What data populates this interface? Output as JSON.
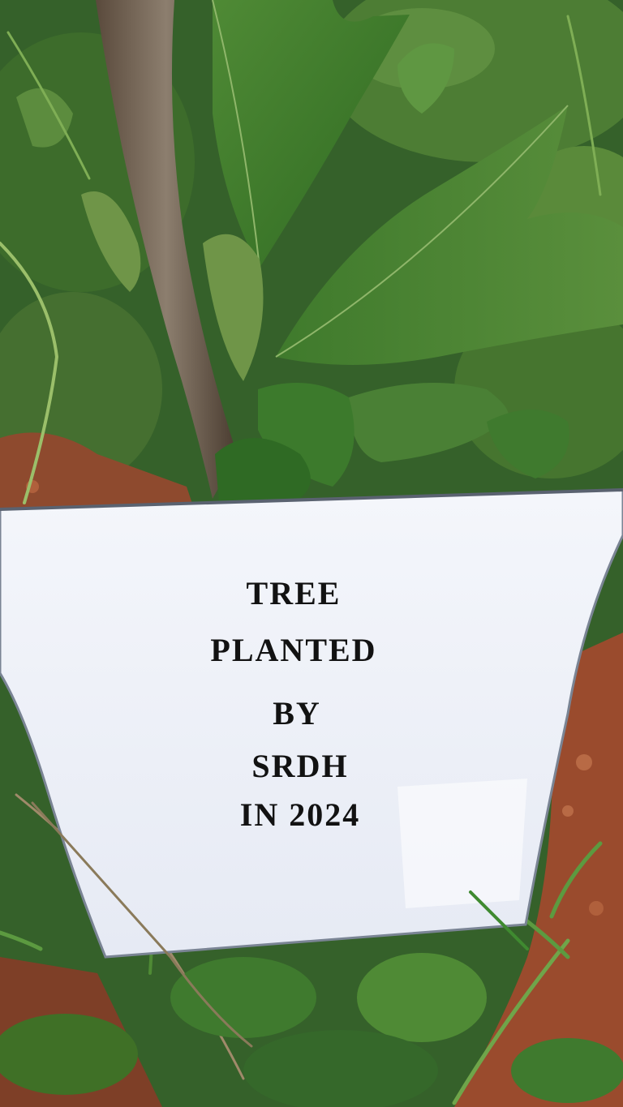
{
  "sign": {
    "lines": [
      "TREE",
      "PLANTED",
      "BY",
      "SRDH",
      "IN 2024"
    ]
  },
  "colors": {
    "foliage_dark": "#2f5a22",
    "foliage_light": "#5f8f3e",
    "soil": "#9a4a2c",
    "paper": "#eef1f8",
    "text": "#121212"
  }
}
